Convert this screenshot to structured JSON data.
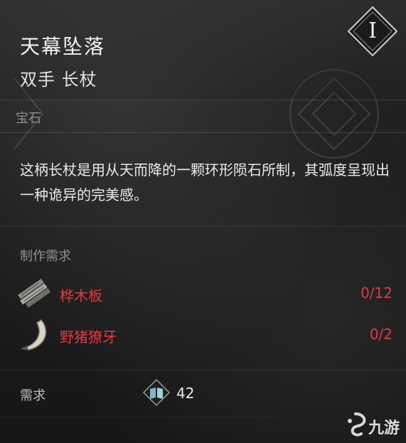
{
  "item": {
    "name": "天幕坠落",
    "type": "双手 长杖",
    "tier": "I",
    "category": "宝石",
    "description": "这柄长杖是用从天而降的一颗环形陨石所制，其弧度呈现出一种诡异的完美感。"
  },
  "crafting": {
    "label": "制作需求",
    "materials": [
      {
        "name": "桦木板",
        "count": "0/12",
        "icon": "birch-plank-icon"
      },
      {
        "name": "野猪獠牙",
        "count": "0/2",
        "icon": "boar-tusk-icon"
      }
    ]
  },
  "requirement": {
    "label": "需求",
    "icon": "book-icon",
    "value": "42"
  },
  "watermark": {
    "text": "九游"
  },
  "colors": {
    "missing": "#e03b3b",
    "muted": "#8f8f8f",
    "text": "#eaeaea"
  }
}
